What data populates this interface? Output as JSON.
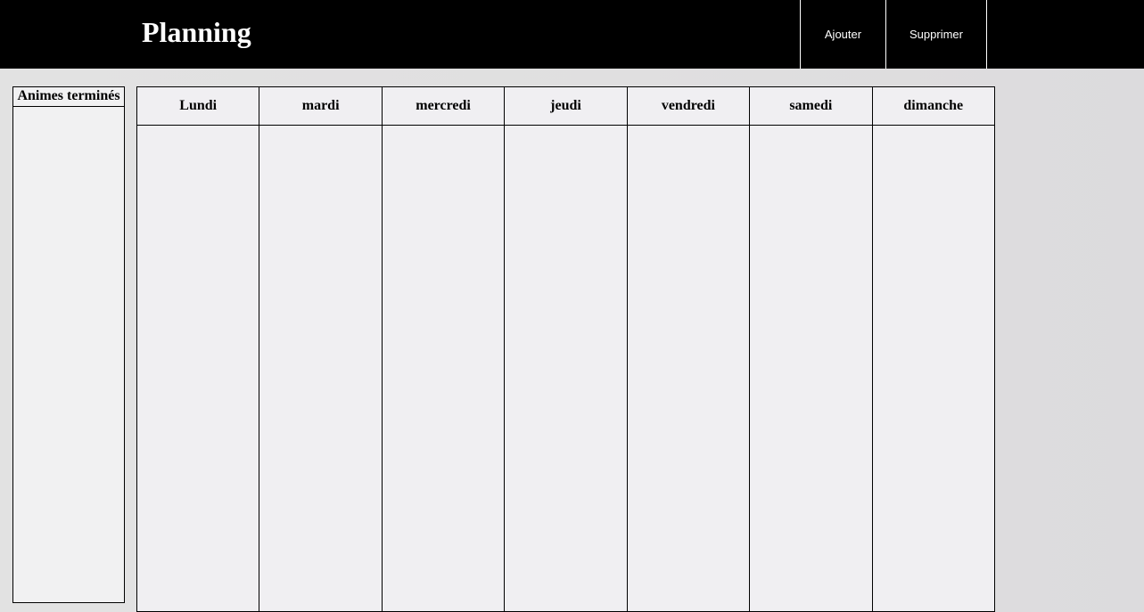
{
  "header": {
    "title": "Planning",
    "buttons": {
      "add": "Ajouter",
      "delete": "Supprimer"
    }
  },
  "sidebar": {
    "title": "Animes terminés"
  },
  "week": {
    "days": [
      "Lundi",
      "mardi",
      "mercredi",
      "jeudi",
      "vendredi",
      "samedi",
      "dimanche"
    ]
  },
  "colors": {
    "header_bg": "#000000",
    "header_text": "#ffffff",
    "page_bg": "#e0dfe0",
    "panel_bg": "#f0eff2"
  }
}
